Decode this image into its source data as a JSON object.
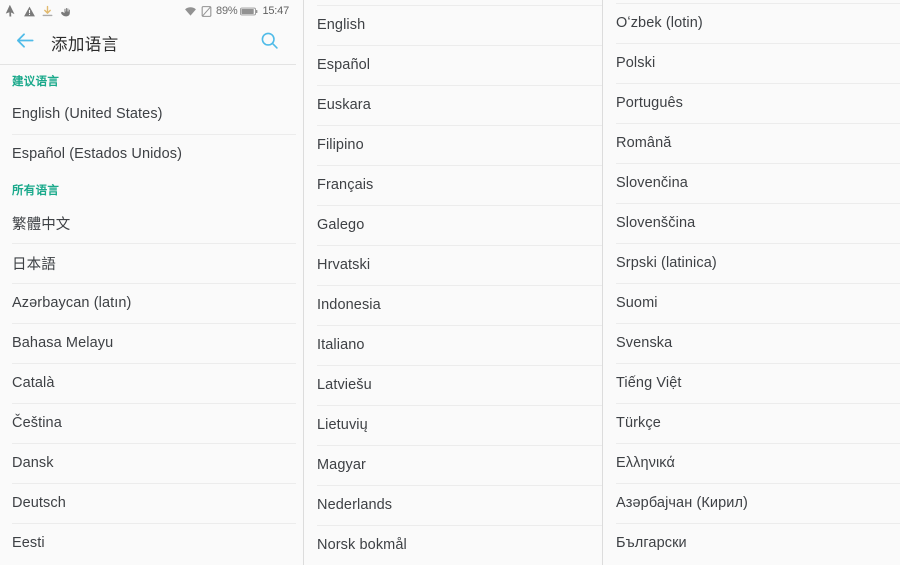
{
  "status_bar": {
    "notification_icons": [
      "cursor-icon",
      "warning-triangle-icon",
      "download-icon",
      "gesture-hand-icon"
    ],
    "wifi_icon": "wifi-icon",
    "sim_icon": "sim-card-icon",
    "battery_percent": "89%",
    "battery_icon": "battery-icon",
    "clock": "15:47"
  },
  "toolbar": {
    "back_icon": "back-arrow-icon",
    "title": "添加语言",
    "search_icon": "search-icon",
    "accent_color": "#4fbbe8"
  },
  "colors": {
    "section_header": "#1aa98b",
    "page_background": "#fafafa",
    "divider": "#ececec",
    "text": "#3e4145"
  },
  "columns": [
    {
      "name": "column-left",
      "sections": [
        {
          "header": "建议语言",
          "items": [
            "English (United States)",
            "Español (Estados Unidos)"
          ]
        },
        {
          "header": "所有语言",
          "items": [
            "繁體中文",
            "日本語",
            "Azərbaycan (latın)",
            "Bahasa Melayu",
            "Català",
            "Čeština",
            "Dansk",
            "Deutsch",
            "Eesti"
          ]
        }
      ]
    },
    {
      "name": "column-middle",
      "sections": [
        {
          "header": null,
          "items": [
            "English",
            "Español",
            "Euskara",
            "Filipino",
            "Français",
            "Galego",
            "Hrvatski",
            "Indonesia",
            "Italiano",
            "Latviešu",
            "Lietuvių",
            "Magyar",
            "Nederlands",
            "Norsk bokmål"
          ]
        }
      ]
    },
    {
      "name": "column-right",
      "sections": [
        {
          "header": null,
          "items": [
            "Oʻzbek (lotin)",
            "Polski",
            "Português",
            "Română",
            "Slovenčina",
            "Slovenščina",
            "Srpski (latinica)",
            "Suomi",
            "Svenska",
            "Tiếng Việt",
            "Türkçe",
            "Ελληνικά",
            "Азәрбајчан (Кирил)",
            "Български"
          ]
        }
      ]
    }
  ]
}
